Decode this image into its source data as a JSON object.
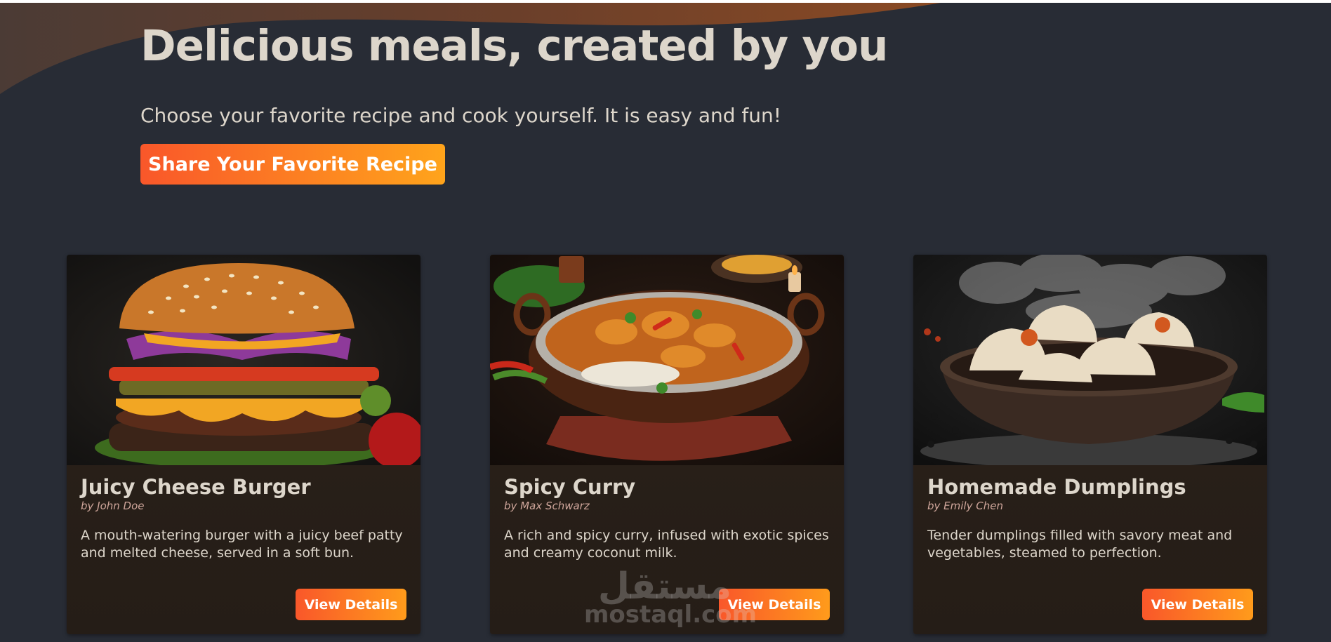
{
  "hero": {
    "title": "Delicious meals, created by you",
    "subtitle": "Choose your favorite recipe and cook yourself. It is easy and fun!",
    "cta_label": "Share Your Favorite Recipe"
  },
  "meals": [
    {
      "title": "Juicy Cheese Burger",
      "author": "by John Doe",
      "summary": "A mouth-watering burger with a juicy beef patty and melted cheese, served in a soft bun.",
      "button_label": "View Details"
    },
    {
      "title": "Spicy Curry",
      "author": "by Max Schwarz",
      "summary": "A rich and spicy curry, infused with exotic spices and creamy coconut milk.",
      "button_label": "View Details"
    },
    {
      "title": "Homemade Dumplings",
      "author": "by Emily Chen",
      "summary": "Tender dumplings filled with savory meat and vegetables, steamed to perfection.",
      "button_label": "View Details"
    }
  ],
  "watermark": {
    "arabic": "مستقل",
    "latin": "mostaql.com"
  },
  "colors": {
    "background": "#282c35",
    "text": "#ddd6cb",
    "accent_start": "#f9572a",
    "accent_end": "#ffa41b",
    "author": "#cfa69b"
  }
}
